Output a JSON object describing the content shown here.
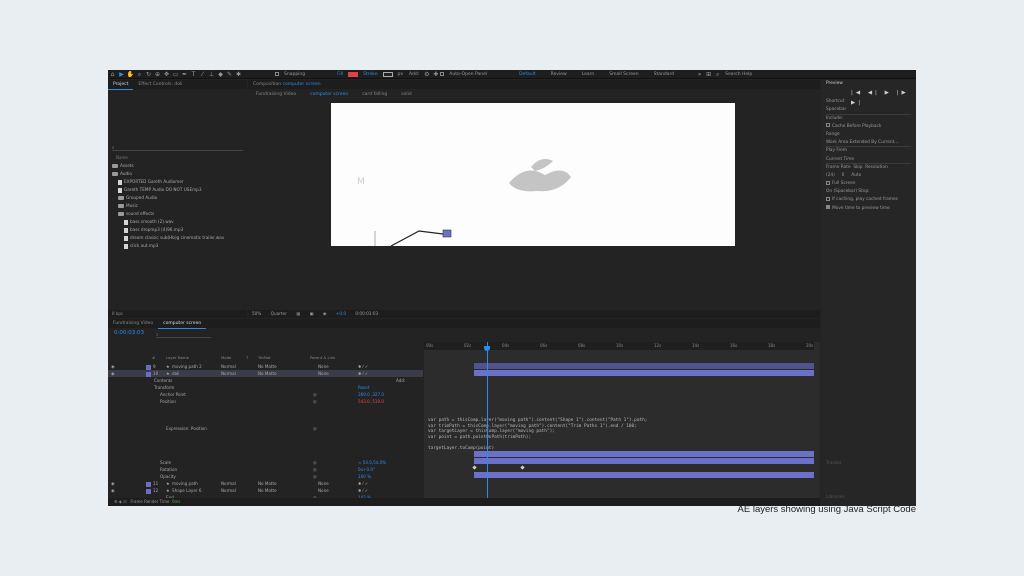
{
  "toolbar": {
    "snapping": "Snapping",
    "fill": "Fill",
    "stroke": "Stroke",
    "stroke_px": "px",
    "add": "Add:",
    "auto_open": "Auto-Open Panel",
    "workspaces": [
      "Default",
      "Review",
      "Learn",
      "Small Screen",
      "Standard"
    ],
    "search_help": "Search Help",
    "fill_color": "#e0404a"
  },
  "project": {
    "tabs": [
      "Project",
      "Effect Controls: doli"
    ],
    "search": "⌕",
    "col_name": "Name",
    "items": [
      {
        "kind": "folder",
        "label": "Assets",
        "indent": 0
      },
      {
        "kind": "folder",
        "label": "Audio",
        "indent": 0
      },
      {
        "kind": "file",
        "label": "EXPORTED Gareth Audiomer",
        "indent": 1
      },
      {
        "kind": "file",
        "label": "Gareth TEMP Audio DO NOT USEmp3",
        "indent": 1
      },
      {
        "kind": "folder",
        "label": "Grouped Audio",
        "indent": 1
      },
      {
        "kind": "folder",
        "label": "Music",
        "indent": 1
      },
      {
        "kind": "folder",
        "label": "sound effects",
        "indent": 1
      },
      {
        "kind": "file",
        "label": "bass smooth (2).wav",
        "indent": 2
      },
      {
        "kind": "file",
        "label": "bass dropmp3 (4)96.mp3",
        "indent": 2
      },
      {
        "kind": "file",
        "label": "dream classic sub(Hb)g cinematic trailer.wav",
        "indent": 2
      },
      {
        "kind": "file",
        "label": "click out.mp3",
        "indent": 2
      }
    ],
    "footer": "8 bpc"
  },
  "comp": {
    "tab": "Composition",
    "tab_name": "computer screen",
    "subtabs": [
      "Fundraising Video",
      "computer screen",
      "card falling",
      "solid"
    ],
    "active_subtab": 1,
    "canvas_mark": "M",
    "viewer_bar": {
      "zoom": "50%",
      "resolution": "Quarter",
      "exposure": "+0.0",
      "timecode": "0:00:03:03"
    }
  },
  "right": {
    "preview": "Preview",
    "transport": "|◀ ◀| ▶ |▶ ▶|",
    "shortcut_label": "Shortcut",
    "shortcut": "Spacebar",
    "include": "Include:",
    "cache_before": "Cache Before Playback",
    "range_label": "Range",
    "range": "Work Area Extended By Current...",
    "play_from": "Play From",
    "play_from_val": "Current Time",
    "frame_rate_label": "Frame Rate",
    "skip_label": "Skip",
    "resolution_label": "Resolution",
    "frame_rate": "(24)",
    "skip": "0",
    "resolution": "Auto",
    "full_screen": "Full Screen",
    "on_stop": "On (Spacebar) Stop:",
    "if_caching": "If caching, play cached frames",
    "move_time": "Move time to preview time",
    "dim_items": [
      "Tracker",
      "Libraries"
    ]
  },
  "timeline": {
    "tabs": [
      "Fundraising Video",
      "computer screen"
    ],
    "timecode": "0:00:03:03",
    "search": "⌕",
    "columns": [
      "#",
      "Layer Name",
      "Mode",
      "T",
      "TrkMat",
      "Parent & Link"
    ],
    "ruler": [
      "00s",
      "02s",
      "04s",
      "06s",
      "08s",
      "10s",
      "12s",
      "14s",
      "16s",
      "18s",
      "20s"
    ],
    "rows": [
      {
        "num": "9",
        "name": "moving path 2",
        "mode": "Normal",
        "trk": "No Matte",
        "parent": "None",
        "sel": false
      },
      {
        "num": "10",
        "name": "doli",
        "mode": "Normal",
        "trk": "No Matte",
        "parent": "None",
        "sel": true
      },
      {
        "sub": "Contents",
        "indent": 1,
        "value": "",
        "add": "Add:"
      },
      {
        "sub": "Transform",
        "indent": 1,
        "value": "Reset"
      },
      {
        "sub": "Anchor Point",
        "indent": 2,
        "value": "369.0 ,327.0"
      },
      {
        "sub": "Position",
        "indent": 2,
        "value": "543.0 ,519.0",
        "red": true
      },
      {
        "sub": "Expression: Position",
        "indent": 3,
        "value": ""
      },
      {
        "sub": "Scale",
        "indent": 2,
        "value": "∞ 54.0,54.0%"
      },
      {
        "sub": "Rotation",
        "indent": 2,
        "value": "0x+0.0°"
      },
      {
        "sub": "Opacity",
        "indent": 2,
        "value": "100 %"
      },
      {
        "num": "11",
        "name": "moving path",
        "mode": "Normal",
        "trk": "No Matte",
        "parent": "None",
        "sel": false
      },
      {
        "num": "12",
        "name": "Shape Layer 6",
        "mode": "Normal",
        "trk": "No Matte",
        "parent": "None",
        "sel": false
      },
      {
        "sub": "End",
        "indent": 3,
        "value": "142 %"
      },
      {
        "num": "13",
        "name": "Shape Layer 6",
        "mode": "Normal",
        "trk": "No Matte",
        "parent": "None",
        "sel": false
      },
      {
        "sub": "Contents",
        "indent": 1,
        "value": "",
        "add": "Add:"
      },
      {
        "sub": "Shape 1",
        "indent": 2,
        "value": "Normal"
      },
      {
        "sub": "Trim Paths 1",
        "indent": 2,
        "value": ""
      },
      {
        "sub": "Start",
        "indent": 3,
        "value": "97.0 %"
      },
      {
        "sub": "End",
        "indent": 3,
        "value": "100.0 %"
      }
    ],
    "expression": "var path = thisComp.layer(\"moving path\").content(\"Shape 1\").content(\"Path 1\").path;\nvar trimPath = thisComp.layer(\"moving path\").content(\"Trim Paths 1\").end / 100;\nvar targetLayer = thisComp.layer(\"moving path\");\nvar point = path.pointOnPath(trimPath);\n\ntargetLayer.toComp(point)",
    "footer_label": "Frame Render Time",
    "footer_value": "0ms"
  },
  "caption": "AE layers showing using Java Script Code"
}
